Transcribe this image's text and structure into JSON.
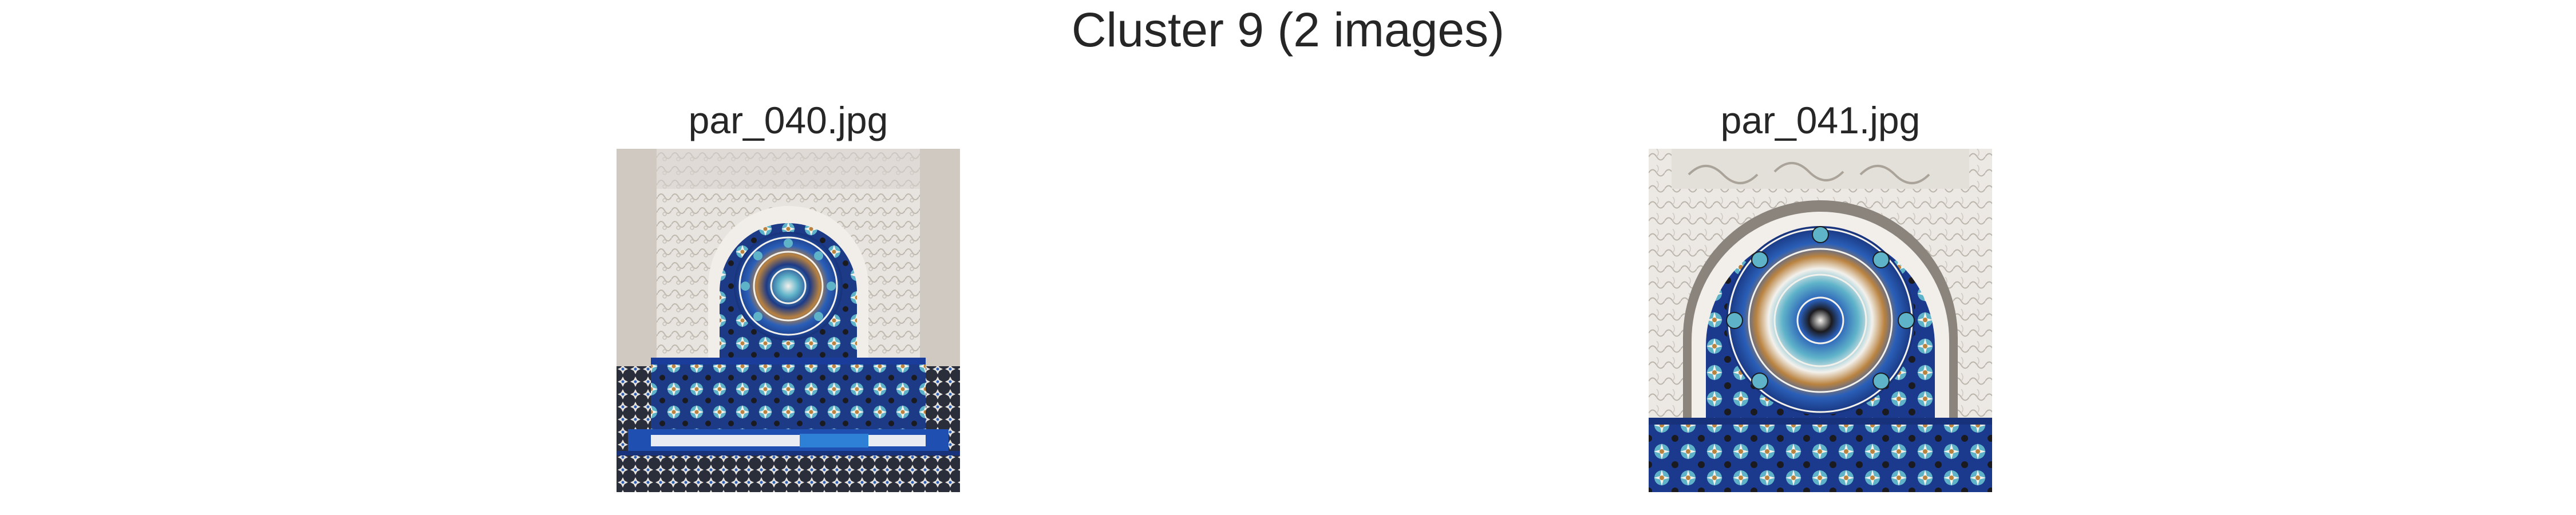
{
  "figure": {
    "title": "Cluster 9 (2 images)"
  },
  "panels": [
    {
      "filename": "par_040.jpg",
      "image_description": "Ornate zellige tile fountain alcove with blue mosaic arch, white carved stucco surround and a tiled basin"
    },
    {
      "filename": "par_041.jpg",
      "image_description": "Close-up of a Moroccan zellige mosaic arch with a central star rosette in blue tones and carved white plaster above"
    }
  ],
  "colors": {
    "stucco": "#e9e6e2",
    "stucco_shadow": "#c9c4bd",
    "tile_blue_dark": "#17327a",
    "tile_blue": "#2a5fb8",
    "tile_turquoise": "#5fb3c9",
    "tile_ochre": "#b9823f",
    "tile_white": "#f3f1ec",
    "tile_black": "#1b1b1f"
  }
}
